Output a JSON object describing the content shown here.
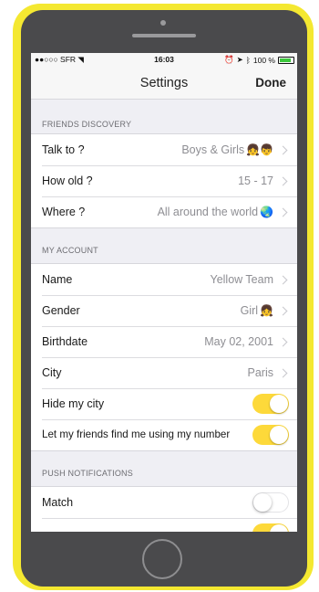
{
  "status_bar": {
    "carrier": "●●○○○ SFR",
    "time": "16:03",
    "battery": "100 %"
  },
  "nav": {
    "title": "Settings",
    "done": "Done"
  },
  "friends_discovery": {
    "header": "FRIENDS DISCOVERY",
    "rows": [
      {
        "label": "Talk to ?",
        "value": "Boys & Girls",
        "emoji": "👧👦"
      },
      {
        "label": "How old ?",
        "value": "15 - 17",
        "emoji": ""
      },
      {
        "label": "Where ?",
        "value": "All around the world",
        "emoji": "🌏"
      }
    ]
  },
  "my_account": {
    "header": "MY ACCOUNT",
    "rows": [
      {
        "label": "Name",
        "value": "Yellow Team",
        "emoji": ""
      },
      {
        "label": "Gender",
        "value": "Girl",
        "emoji": "👧"
      },
      {
        "label": "Birthdate",
        "value": "May 02, 2001",
        "emoji": ""
      },
      {
        "label": "City",
        "value": "Paris",
        "emoji": ""
      }
    ],
    "toggles": [
      {
        "label": "Hide my city",
        "on": true
      },
      {
        "label": "Let my friends find me using my number",
        "on": true
      }
    ]
  },
  "push_notifications": {
    "header": "PUSH NOTIFICATIONS",
    "toggles": [
      {
        "label": "Match",
        "on": false
      }
    ]
  },
  "colors": {
    "accent_yellow": "#fdd93a",
    "device_frame": "#f4e831",
    "battery_green": "#3cc83c"
  },
  "icons": [
    "wifi-icon",
    "alarm-icon",
    "location-arrow-icon",
    "bluetooth-icon",
    "battery-icon",
    "chevron-right-icon"
  ]
}
